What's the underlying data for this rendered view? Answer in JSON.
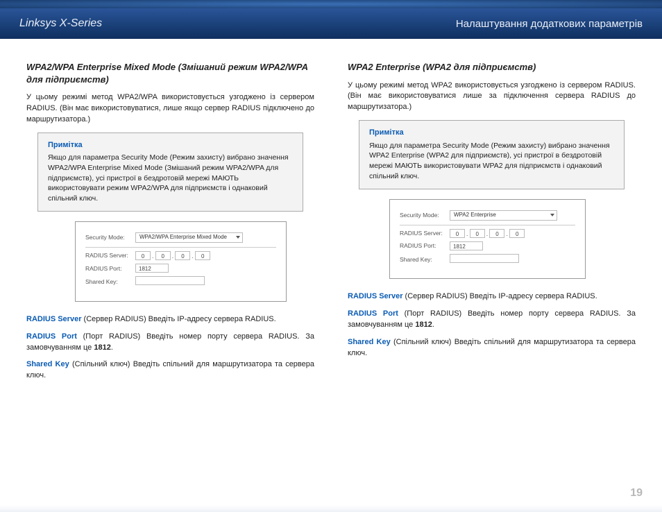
{
  "header": {
    "left": "Linksys X-Series",
    "right": "Налаштування додаткових параметрів"
  },
  "page_number": "19",
  "left_col": {
    "title": "WPA2/WPA Enterprise Mixed Mode (Змішаний режим WPA2/WPA для підприємств)",
    "intro": "У цьому режимі метод WPA2/WPA використовується узгоджено із сервером RADIUS. (Він має використовуватися, лише якщо сервер RADIUS підключено до маршрутизатора.)",
    "note_title": "Примітка",
    "note_body": "Якщо для параметра Security Mode (Режим захисту) вибрано значення WPA2/WPA Enterprise Mixed Mode (Змішаний режим WPA2/WPA для підприємств), усі пристрої в бездротовій мережі МАЮТЬ використовувати режим WPA2/WPA для підприємств і однаковий спільний ключ.",
    "config": {
      "mode_label": "Security Mode:",
      "mode_value": "WPA2/WPA Enterprise Mixed Mode",
      "radius_server_label": "RADIUS Server:",
      "ip": [
        "0",
        "0",
        "0",
        "0"
      ],
      "radius_port_label": "RADIUS Port:",
      "radius_port_value": "1812",
      "shared_key_label": "Shared Key:"
    },
    "defs": {
      "radius_server_term": "RADIUS Server",
      "radius_server_text": " (Сервер RADIUS)  Введіть IP-адресу сервера RADIUS.",
      "radius_port_term": "RADIUS Port",
      "radius_port_text": " (Порт RADIUS) Введіть номер порту сервера RADIUS. За замовчуванням це ",
      "radius_port_default": "1812",
      "shared_key_term": "Shared Key",
      "shared_key_text": " (Спільний ключ) Введіть спільний для маршрутизатора та сервера ключ."
    }
  },
  "right_col": {
    "title": "WPA2 Enterprise (WPA2 для підприємств)",
    "intro": "У цьому режимі метод WPA2 використовується узгоджено із сервером RADIUS. (Він має використовуватися лише за підключення сервера RADIUS до маршрутизатора.)",
    "note_title": "Примітка",
    "note_body": "Якщо для параметра Security Mode (Режим захисту) вибрано значення WPA2 Enterprise (WPA2 для підприємств), усі пристрої в бездротовій мережі МАЮТЬ використовувати WPA2 для підприємств і однаковий спільний ключ.",
    "config": {
      "mode_label": "Security Mode:",
      "mode_value": "WPA2 Enterprise",
      "radius_server_label": "RADIUS Server:",
      "ip": [
        "0",
        "0",
        "0",
        "0"
      ],
      "radius_port_label": "RADIUS Port:",
      "radius_port_value": "1812",
      "shared_key_label": "Shared Key:"
    },
    "defs": {
      "radius_server_term": "RADIUS Server",
      "radius_server_text": " (Сервер RADIUS)  Введіть IP-адресу сервера RADIUS.",
      "radius_port_term": "RADIUS Port",
      "radius_port_text": " (Порт RADIUS) Введіть номер порту сервера RADIUS. За замовчуванням це ",
      "radius_port_default": "1812",
      "shared_key_term": "Shared Key",
      "shared_key_text": " (Спільний ключ) Введіть спільний для маршрутизатора та сервера ключ."
    }
  }
}
